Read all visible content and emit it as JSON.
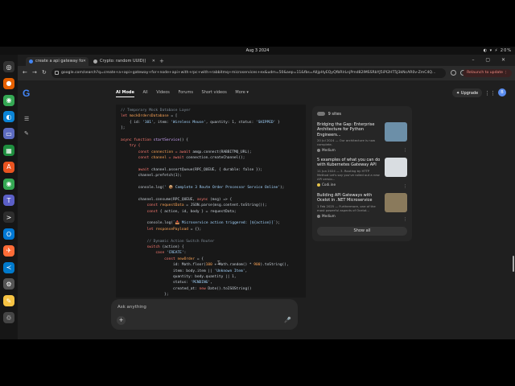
{
  "system": {
    "date": "Aug 3  2024",
    "status": "◐ ▾ ⚡ 20%"
  },
  "dock": {
    "items": [
      {
        "name": "ubuntu",
        "glyph": "◎",
        "color": "#333333"
      },
      {
        "name": "firefox",
        "glyph": "●",
        "color": "#e66000"
      },
      {
        "name": "chrome",
        "glyph": "◉",
        "color": "#34a853"
      },
      {
        "name": "edge",
        "glyph": "◐",
        "color": "#0a84d6"
      },
      {
        "name": "files",
        "glyph": "▭",
        "color": "#5c6bc0"
      },
      {
        "name": "spreadsheet",
        "glyph": "▦",
        "color": "#1e8e3e"
      },
      {
        "name": "software",
        "glyph": "A",
        "color": "#e95420"
      },
      {
        "name": "chrome-2",
        "glyph": "◉",
        "color": "#34a853"
      },
      {
        "name": "teams",
        "glyph": "T",
        "color": "#5b5fc7"
      },
      {
        "name": "terminal",
        "glyph": ">",
        "color": "#2d2d2d"
      },
      {
        "name": "outlook",
        "glyph": "O",
        "color": "#0078d4"
      },
      {
        "name": "postman",
        "glyph": "✈",
        "color": "#ff6c37"
      },
      {
        "name": "vscode",
        "glyph": "≺",
        "color": "#007acc"
      },
      {
        "name": "settings",
        "glyph": "⚙",
        "color": "#555555"
      },
      {
        "name": "notes",
        "glyph": "✎",
        "color": "#f6c343"
      },
      {
        "name": "trash",
        "glyph": "♲",
        "color": "#444444"
      }
    ]
  },
  "browser": {
    "tabs": [
      {
        "title": "create a api gateway fo",
        "active": true,
        "fav_color": "#4285f4"
      },
      {
        "title": "Crypto: random UUID()",
        "active": false,
        "fav_color": "#aaaaaa"
      }
    ],
    "new_tab": "+",
    "window_buttons": "– ▢ ✕",
    "url": "google.com/search?q=create+a+api+gateway+for+node+api+with+rpc+with+rabbitmq+microservices+ex&udm=50&aep=11&fbs=AIIjpHyEQyQfbRlrLnjPmd82IMSSRbYJ5iPI2HT5J3kNcAR0v-ZmC4Q...",
    "relaunch": "Relaunch to update  ⋮"
  },
  "google": {
    "logo": "G",
    "tabs": [
      "AI Mode",
      "All",
      "Videos",
      "Forums",
      "Short videos",
      "More ▾"
    ],
    "upgrade": "✦ Upgrade",
    "apps_icon": "⋮⋮",
    "avatar": "B"
  },
  "code": {
    "lines": [
      [
        {
          "t": "// Temporary Mock Database Layer",
          "c": "c-com"
        }
      ],
      [
        {
          "t": "let ",
          "c": "c-kw"
        },
        {
          "t": "mockOrdersDatabase",
          "c": "c-var"
        },
        {
          "t": " = [",
          "c": ""
        }
      ],
      [
        {
          "t": "    { id: ",
          "c": ""
        },
        {
          "t": "'101'",
          "c": "c-str"
        },
        {
          "t": ", item: ",
          "c": ""
        },
        {
          "t": "'Wireless Mouse'",
          "c": "c-str"
        },
        {
          "t": ", quantity: 1, status: ",
          "c": ""
        },
        {
          "t": "'SHIPPED'",
          "c": "c-str"
        },
        {
          "t": " }",
          "c": ""
        }
      ],
      [
        {
          "t": "];",
          "c": ""
        }
      ],
      [
        {
          "t": "",
          "c": ""
        }
      ],
      [
        {
          "t": "async function ",
          "c": "c-kw"
        },
        {
          "t": "startService",
          "c": "c-fn"
        },
        {
          "t": "() {",
          "c": ""
        }
      ],
      [
        {
          "t": "    try {",
          "c": "c-kw"
        }
      ],
      [
        {
          "t": "        const ",
          "c": "c-kw"
        },
        {
          "t": "connection",
          "c": "c-var"
        },
        {
          "t": " = await ",
          "c": "c-kw"
        },
        {
          "t": "amqp.connect(RABBITMQ_URL);",
          "c": ""
        }
      ],
      [
        {
          "t": "        const ",
          "c": "c-kw"
        },
        {
          "t": "channel",
          "c": "c-var"
        },
        {
          "t": " = await ",
          "c": "c-kw"
        },
        {
          "t": "connection.createChannel();",
          "c": ""
        }
      ],
      [
        {
          "t": "",
          "c": ""
        }
      ],
      [
        {
          "t": "        await ",
          "c": "c-kw"
        },
        {
          "t": "channel.assertQueue(RPC_QUEUE, { durable: false });",
          "c": ""
        }
      ],
      [
        {
          "t": "        channel.prefetch(1);",
          "c": ""
        }
      ],
      [
        {
          "t": "",
          "c": ""
        }
      ],
      [
        {
          "t": "        console.log(",
          "c": ""
        },
        {
          "t": "' 📦 Complete 3 Route Order Processor Service Online'",
          "c": "c-str"
        },
        {
          "t": ");",
          "c": ""
        }
      ],
      [
        {
          "t": "",
          "c": ""
        }
      ],
      [
        {
          "t": "        channel.consume(RPC_QUEUE, ",
          "c": ""
        },
        {
          "t": "async ",
          "c": "c-kw"
        },
        {
          "t": "(msg) => {",
          "c": ""
        }
      ],
      [
        {
          "t": "            const ",
          "c": "c-kw"
        },
        {
          "t": "requestData",
          "c": "c-var"
        },
        {
          "t": " = JSON.parse(msg.content.toString());",
          "c": ""
        }
      ],
      [
        {
          "t": "            const ",
          "c": "c-kw"
        },
        {
          "t": "{ action, id, body } = requestData;",
          "c": ""
        }
      ],
      [
        {
          "t": "",
          "c": ""
        }
      ],
      [
        {
          "t": "            console.log(",
          "c": ""
        },
        {
          "t": "`📥 Microservice action triggered: [${action}]`",
          "c": "c-str"
        },
        {
          "t": ");",
          "c": ""
        }
      ],
      [
        {
          "t": "            let ",
          "c": "c-kw"
        },
        {
          "t": "responsePayload",
          "c": "c-var"
        },
        {
          "t": " = {};",
          "c": ""
        }
      ],
      [
        {
          "t": "",
          "c": ""
        }
      ],
      [
        {
          "t": "            // Dynamic Action Switch Router",
          "c": "c-com"
        }
      ],
      [
        {
          "t": "            switch ",
          "c": "c-kw"
        },
        {
          "t": "(action) {",
          "c": ""
        }
      ],
      [
        {
          "t": "                case ",
          "c": "c-kw"
        },
        {
          "t": "'CREATE'",
          "c": "c-str"
        },
        {
          "t": ":",
          "c": ""
        }
      ],
      [
        {
          "t": "                    const ",
          "c": "c-kw"
        },
        {
          "t": "newOrder",
          "c": "c-var"
        },
        {
          "t": " = {",
          "c": ""
        }
      ],
      [
        {
          "t": "                        id: Math.floor(",
          "c": ""
        },
        {
          "t": "100",
          "c": "c-var"
        },
        {
          "t": " + Math.random() * ",
          "c": ""
        },
        {
          "t": "900",
          "c": "c-var"
        },
        {
          "t": ").toString(),",
          "c": ""
        }
      ],
      [
        {
          "t": "                        item: body.item || ",
          "c": ""
        },
        {
          "t": "'Unknown Item'",
          "c": "c-str"
        },
        {
          "t": ",",
          "c": ""
        }
      ],
      [
        {
          "t": "                        quantity: body.quantity || 1,",
          "c": ""
        }
      ],
      [
        {
          "t": "                        status: ",
          "c": ""
        },
        {
          "t": "'PENDING'",
          "c": "c-str"
        },
        {
          "t": ",",
          "c": ""
        }
      ],
      [
        {
          "t": "                        created_at: ",
          "c": ""
        },
        {
          "t": "new ",
          "c": "c-kw"
        },
        {
          "t": "Date().toISOString()",
          "c": ""
        }
      ],
      [
        {
          "t": "                    };",
          "c": ""
        }
      ]
    ]
  },
  "ask": {
    "placeholder": "Ask anything",
    "plus": "+",
    "mic": "🎤"
  },
  "sources": {
    "header": "9 sites",
    "items": [
      {
        "title": "Bridging the Gap: Enterprise Architecture for Python Engineers...",
        "desc": "20 Jul 2024 — Our architecture is now complete.",
        "site": "Medium",
        "site_color": "#888888",
        "thumb_color": "#6c8fa8"
      },
      {
        "title": "5 examples of what you can do with Kubernetes Gateway API",
        "desc": "11 Jun 2024 — 3. Routing by HTTP Method Let's say you've rolled out a new API versio...",
        "site": "Codi.ine",
        "site_color": "#e6c34a",
        "thumb_color": "#d9dde1"
      },
      {
        "title": "Building API Gateways with Ocelot in .NET Microservice",
        "desc": "1 Feb 2025 — Furthermore, one of the most powerful aspects of Ocelot...",
        "site": "Medium",
        "site_color": "#888888",
        "thumb_color": "#8a7a5c"
      }
    ],
    "show_all": "Show all"
  }
}
